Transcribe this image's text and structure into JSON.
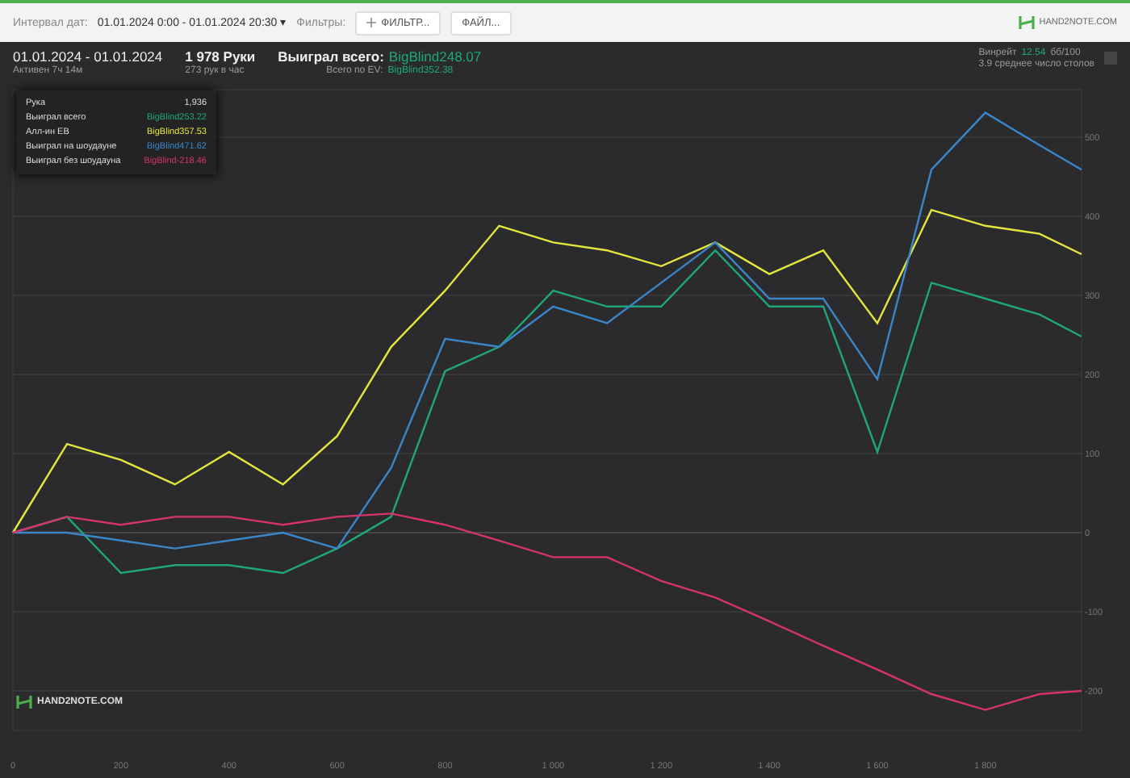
{
  "toolbar": {
    "date_label": "Интервал дат:",
    "date_value": "01.01.2024 0:00 - 01.01.2024 20:30",
    "date_caret": "▾",
    "filters_label": "Фильтры:",
    "filter_button": "ФИЛЬТР...",
    "file_button": "ФАЙЛ...",
    "logo": "HAND2NOTE.COM"
  },
  "summary": {
    "period": "01.01.2024 - 01.01.2024",
    "active": "Активен 7ч 14м",
    "hands": "1 978 Руки",
    "hands_rate": "273 рук в час",
    "won_label": "Выиграл всего:",
    "won_value": "BigBlind248.07",
    "ev_label": "Всего по EV:",
    "ev_value": "BigBlind352.38",
    "winrate_label": "Винрейт",
    "winrate_value": "12.54",
    "winrate_unit": "бб/100",
    "tables": "3.9 среднее число столов"
  },
  "tooltip": {
    "rows": [
      {
        "label": "Рука",
        "value": "1,936"
      },
      {
        "label": "Выиграл всего",
        "value": "BigBlind253.22",
        "color": "#1fa67a"
      },
      {
        "label": "Алл-ин EB",
        "value": "BigBlind357.53",
        "color": "#e3e63c"
      },
      {
        "label": "Выиграл на шоудауне",
        "value": "BigBlind471.62",
        "color": "#3a86c8"
      },
      {
        "label": "Выиграл без шоудауна",
        "value": "BigBlind-218.46",
        "color": "#d6336c"
      }
    ]
  },
  "chart_logo": "HAND2NOTE.COM",
  "chart_data": {
    "type": "line",
    "x": [
      0,
      100,
      200,
      300,
      400,
      500,
      600,
      700,
      800,
      900,
      1000,
      1100,
      1200,
      1300,
      1400,
      1500,
      1600,
      1700,
      1800,
      1900,
      1978
    ],
    "grid": true,
    "xlim": [
      0,
      1978
    ],
    "ylim": [
      -250,
      560
    ],
    "xticks": [
      0,
      200,
      400,
      600,
      800,
      {
        "value": 1000,
        "label": "1 000"
      },
      {
        "value": 1200,
        "label": "1 200"
      },
      {
        "value": 1400,
        "label": "1 400"
      },
      {
        "value": 1600,
        "label": "1 600"
      },
      {
        "value": 1800,
        "label": "1 800"
      }
    ],
    "yticks": [
      500,
      400,
      300,
      200,
      100,
      0,
      -100,
      -200
    ],
    "series": [
      {
        "color": "#1fa67a",
        "values": [
          0,
          20,
          -51,
          -41,
          -41,
          -51,
          -20,
          20,
          204,
          235,
          306,
          286,
          286,
          357,
          286,
          286,
          102,
          316,
          296,
          276,
          248
        ]
      },
      {
        "color": "#e3e63c",
        "values": [
          0,
          112,
          92,
          61,
          102,
          61,
          122,
          235,
          306,
          388,
          367,
          357,
          337,
          367,
          327,
          357,
          265,
          408,
          388,
          378,
          352
        ]
      },
      {
        "color": "#3a86c8",
        "values": [
          0,
          0,
          -10,
          -20,
          -10,
          0,
          -20,
          82,
          245,
          235,
          286,
          265,
          316,
          367,
          296,
          296,
          194,
          459,
          531,
          490,
          459
        ]
      },
      {
        "color": "#d6336c",
        "values": [
          0,
          20,
          10,
          20,
          20,
          10,
          20,
          24,
          10,
          -10,
          -31,
          -31,
          -61,
          -82,
          -112,
          -143,
          -173,
          -204,
          -224,
          -204,
          -200
        ]
      }
    ]
  }
}
